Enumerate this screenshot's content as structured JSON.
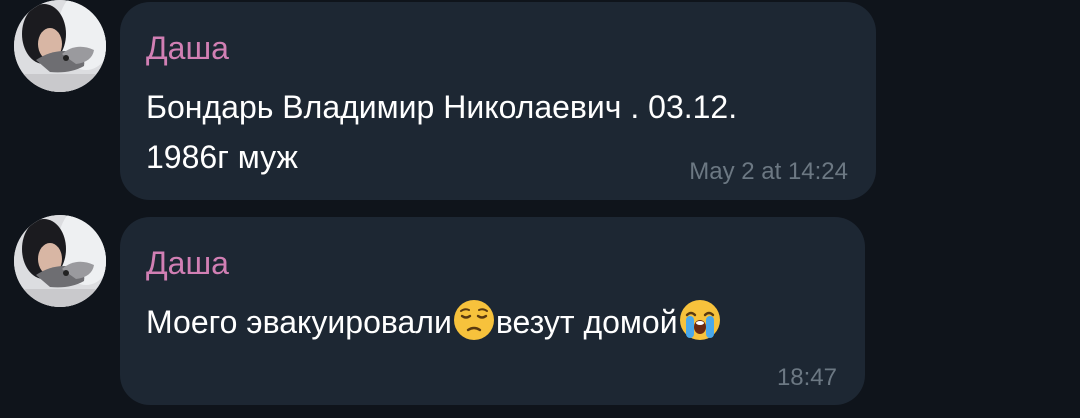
{
  "messages": [
    {
      "sender": "Даша",
      "text_line1": "Бондарь Владимир Николаевич . 03.12.",
      "text_line2": "1986г муж",
      "time": "May 2 at 14:24",
      "avatar_icon": "user-photo-avatar"
    },
    {
      "sender": "Даша",
      "text_part1": "Моего эвакуировали",
      "emoji1": "pensive-face-emoji",
      "text_part2": "везут домой",
      "emoji2": "loudly-crying-face-emoji",
      "time": "18:47",
      "avatar_icon": "user-photo-avatar"
    }
  ],
  "colors": {
    "background": "#0f141b",
    "bubble": "#1d2733",
    "sender_name": "#d17fb4",
    "message_text": "#ffffff",
    "timestamp": "#6c7883"
  }
}
